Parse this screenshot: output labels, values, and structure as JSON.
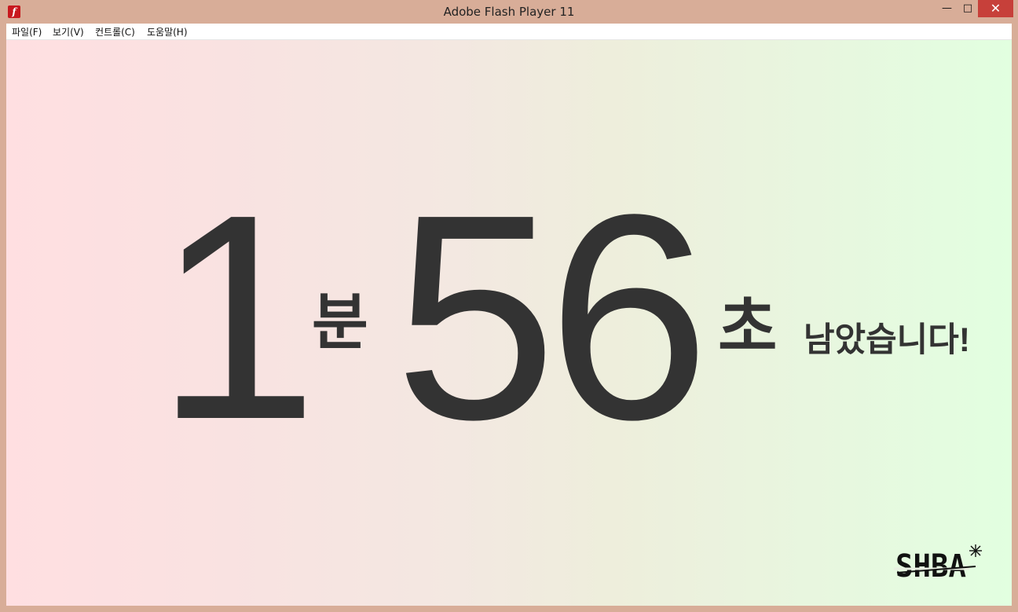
{
  "window": {
    "title": "Adobe Flash Player 11",
    "app_icon": "flash-player-icon",
    "app_icon_glyph": "f",
    "controls": {
      "minimize": "—",
      "maximize": "□",
      "close": "✕"
    }
  },
  "menubar": {
    "items": [
      {
        "label": "파일(F)"
      },
      {
        "label": "보기(V)"
      },
      {
        "label": "컨트롤(C)"
      },
      {
        "label": "도움말(H)"
      }
    ]
  },
  "timer": {
    "minutes": "1",
    "minute_unit": "분",
    "seconds": "56",
    "second_unit": "초",
    "remaining_text": "남았습니다!"
  },
  "logo": {
    "text": "SHBA"
  },
  "colors": {
    "frame": "#d8ad98",
    "close_button": "#c7403a",
    "text": "#333333",
    "gradient_left": "#ffdfe1",
    "gradient_right": "#e2ffe0"
  }
}
